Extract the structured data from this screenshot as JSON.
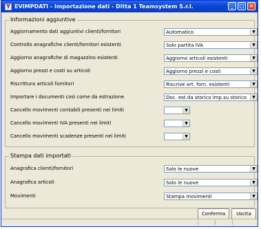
{
  "window": {
    "title": "EVIMPDATI - Importazione dati - Ditta 1 Teamsystem S.r.l.",
    "buttons": [
      "minimize-button",
      "maximize-button",
      "close-button"
    ]
  },
  "info_group": {
    "label": "Informazioni aggiuntive",
    "rows": [
      {
        "label": "Aggiornamento dati aggiuntivi clienti/fornitori",
        "value": "Automatico"
      },
      {
        "label": "Controllo anagrafiche clienti/fornitori esistenti",
        "value": "Solo partita IVA"
      },
      {
        "label": "Aggiorno anagrafiche di magazzino esistenti",
        "value": "Aggiorno articoli esistenti"
      },
      {
        "label": "Aggiorno prezzi e costi su articoli",
        "value": "Aggiorno prezzi e costi"
      },
      {
        "label": "Riscrittura articoli fornitori",
        "value": "Riscrive art. forn. esistenti"
      },
      {
        "label": "Importare i documenti così come da estrazione",
        "value": "Doc. est.da storico imp.su storico"
      },
      {
        "label": "Cancello movimenti contabili presenti nei limiti",
        "value": ""
      },
      {
        "label": "Cancello movimenti IVA presenti nei limiti",
        "value": ""
      },
      {
        "label": "Cancello movimenti scadenze presenti nei limiti",
        "value": ""
      }
    ]
  },
  "print_group": {
    "label": "Stampa dati importati",
    "rows": [
      {
        "label": "Anagrafica clienti/fornitori",
        "value": "Solo le nuove"
      },
      {
        "label": "Anagrafica articoli",
        "value": "Solo le nuove"
      },
      {
        "label": "Movimenti",
        "value": "Stampa movimenti"
      }
    ]
  },
  "footer": {
    "confirm_label": "Conferma",
    "exit_label": "Uscita"
  },
  "icons": {
    "app": "app-icon",
    "dropdown": "chevron-down-icon"
  }
}
